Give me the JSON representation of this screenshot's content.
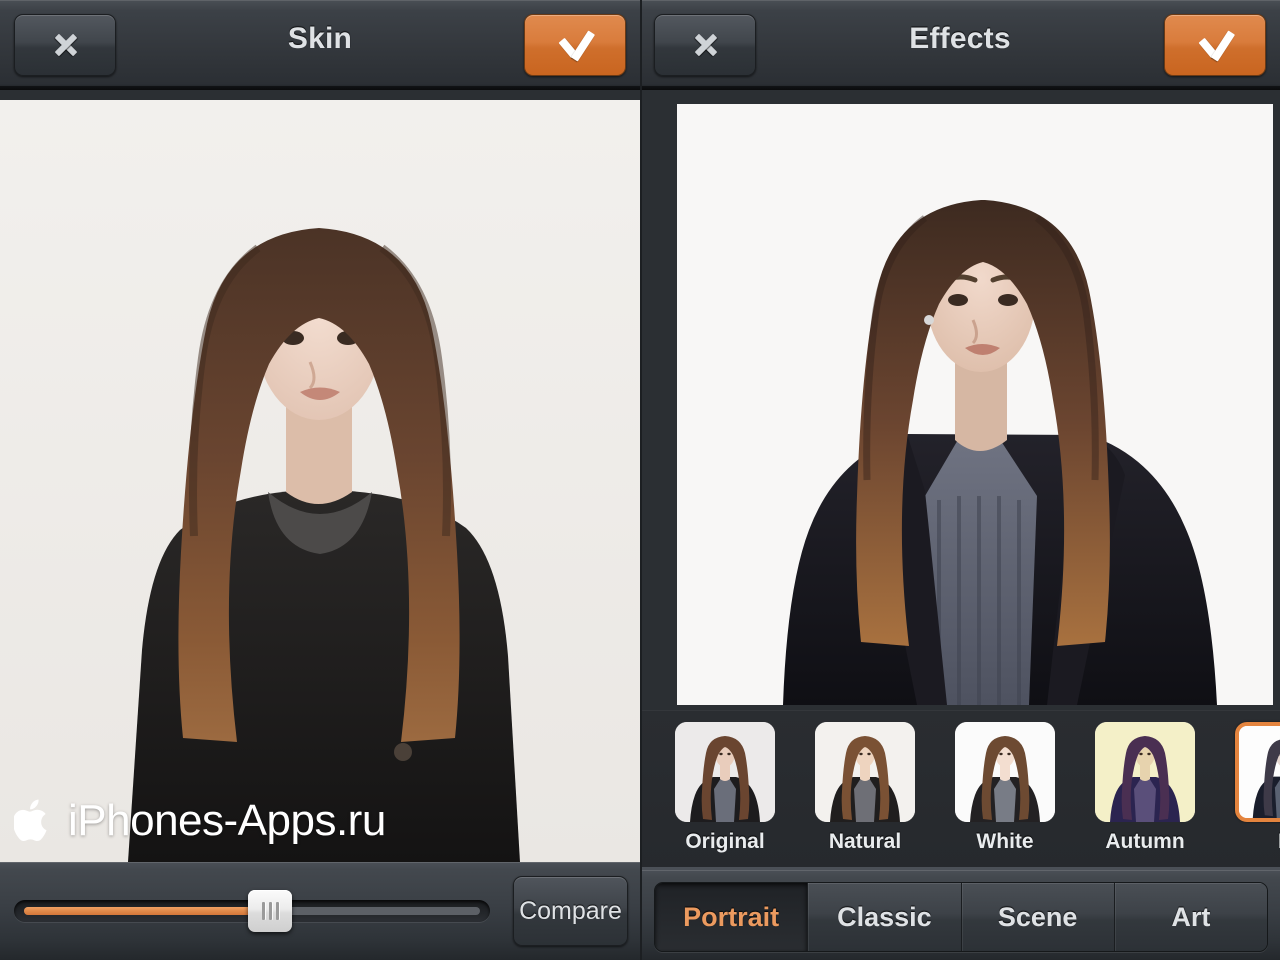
{
  "left_panel": {
    "header": {
      "title": "Skin",
      "close_icon": "close-x-icon",
      "done_icon": "checkmark-icon"
    },
    "photo": {
      "alt": "portrait of woman with long brown hair wearing black coat on light background",
      "watermark": {
        "logo_icon": "apple-logo-icon",
        "text": "iPhones-Apps.ru"
      }
    },
    "footer": {
      "slider": {
        "name": "skin-intensity-slider",
        "value_percent": 54,
        "min": 0,
        "max": 100,
        "fill_color": "#e08a4a"
      },
      "compare_label": "Compare"
    }
  },
  "right_panel": {
    "header": {
      "title": "Effects",
      "close_icon": "close-x-icon",
      "done_icon": "checkmark-icon"
    },
    "photo": {
      "alt": "portrait of woman with long brown hair wearing black leather jacket and grey knit sweater on white background"
    },
    "effects": [
      {
        "label": "Original",
        "selected": false,
        "bg": "#eceaea",
        "tone": "neutral"
      },
      {
        "label": "Natural",
        "selected": false,
        "bg": "#f3f1ee",
        "tone": "warm"
      },
      {
        "label": "White",
        "selected": false,
        "bg": "#fbfbfb",
        "tone": "bright"
      },
      {
        "label": "Autumn",
        "selected": false,
        "bg": "#f4f0c8",
        "tone": "sepia"
      },
      {
        "label": "P",
        "selected": true,
        "bg": "#fdfdfd",
        "tone": "cool"
      }
    ],
    "tabs": [
      {
        "label": "Portrait",
        "active": true
      },
      {
        "label": "Classic",
        "active": false
      },
      {
        "label": "Scene",
        "active": false
      },
      {
        "label": "Art",
        "active": false
      }
    ]
  },
  "theme": {
    "accent": "#e4843e",
    "accent_text": "#eb9a5f",
    "bar_bg": "#3a3f45",
    "strip_bg": "#2a2d31",
    "text": "#dfe2e5"
  }
}
